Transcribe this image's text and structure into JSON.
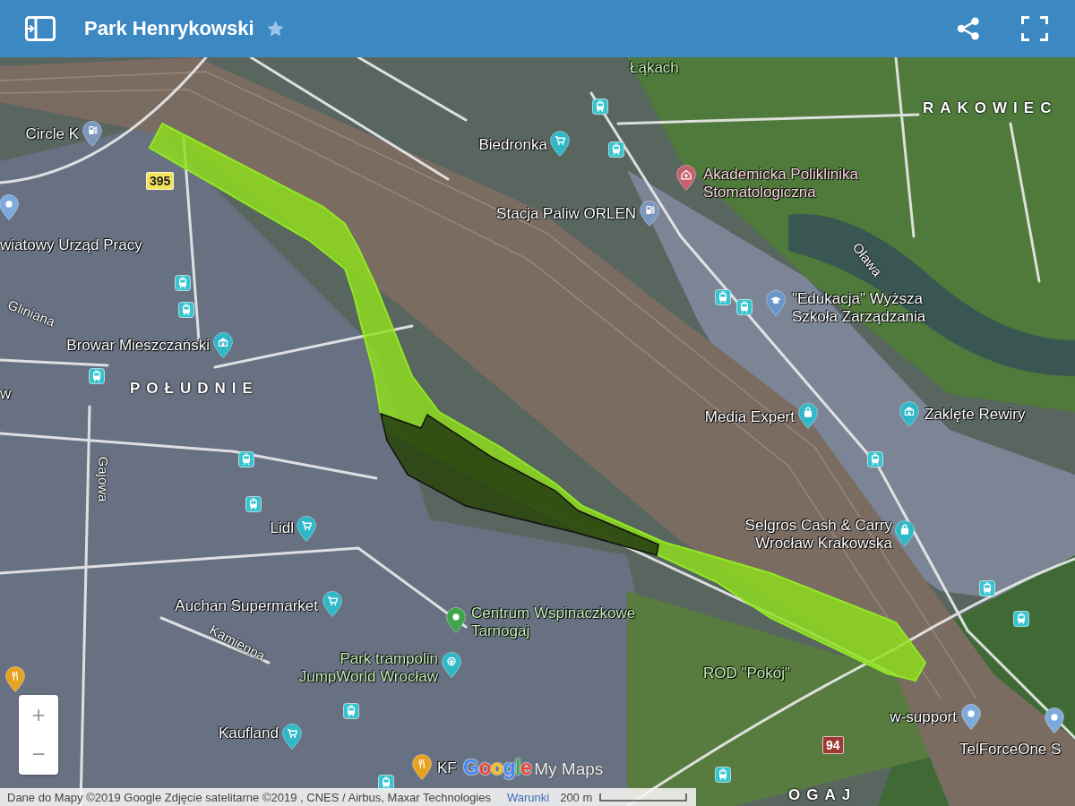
{
  "header": {
    "title": "Park Henrykowski"
  },
  "map": {
    "places": [
      {
        "name": "Łąkach",
        "kind": "none",
        "color": "#c6f2b8"
      },
      {
        "name": "Circle K",
        "kind": "fuel",
        "color": "#ffffff"
      },
      {
        "name": "Biedronka",
        "kind": "cart",
        "color": "#ffffff"
      },
      {
        "name": "Akademicka Poliklinika\nStomatologiczna",
        "kind": "clinic",
        "color": "#fbd7de"
      },
      {
        "name": "Stacja Paliw ORLEN",
        "kind": "fuel",
        "color": "#ffffff"
      },
      {
        "name": "wiatowy Urząd Pracy",
        "kind": "none",
        "color": "#ffffff"
      },
      {
        "name": "\"Edukacja\" Wyższa\nSzkoła Zarządzania",
        "kind": "school",
        "color": "#ffffff"
      },
      {
        "name": "Browar Mieszczański",
        "kind": "landmark",
        "color": "#ffffff"
      },
      {
        "name": "w",
        "kind": "none",
        "color": "#ffffff"
      },
      {
        "name": "Media Expert",
        "kind": "bag",
        "color": "#ffffff"
      },
      {
        "name": "Zaklęte Rewiry",
        "kind": "landmark",
        "color": "#ffffff"
      },
      {
        "name": "Lidl",
        "kind": "cart",
        "color": "#ffffff"
      },
      {
        "name": "Selgros Cash & Carry\nWrocław Krakowska",
        "kind": "bag",
        "color": "#ffffff"
      },
      {
        "name": "Auchan Supermarket",
        "kind": "cart",
        "color": "#ffffff"
      },
      {
        "name": "Centrum Wspinaczkowe\nTarnogaj",
        "kind": "venue",
        "color": "#c6f2b8"
      },
      {
        "name": "Park trampolin\nJumpWorld Wrocław",
        "kind": "amusement",
        "color": "#c6f2b8"
      },
      {
        "name": "ROD \"Pokój\"",
        "kind": "none",
        "color": "#c6f2b8"
      },
      {
        "name": "w-support",
        "kind": "pin",
        "color": "#ffffff"
      },
      {
        "name": "Kaufland",
        "kind": "cart",
        "color": "#ffffff"
      },
      {
        "name": "TelForceOne S",
        "kind": "pin",
        "color": "#ffffff"
      },
      {
        "name": "KF",
        "kind": "food",
        "color": "#ffffff"
      }
    ],
    "districts": [
      "RAKOWIEC",
      "POŁUDNIE",
      "OGAJ"
    ],
    "streets": [
      "Gliniana",
      "Gajowa",
      "Kamienna"
    ],
    "waterways": [
      "Oława"
    ],
    "road_badges": [
      {
        "number": "395",
        "color": "#f2e35a"
      },
      {
        "number": "94",
        "color": "#9a3b34"
      }
    ]
  },
  "zoom_controls": [
    "+",
    "−"
  ],
  "logo": {
    "brand": "Google",
    "product": "My Maps"
  },
  "attribution": {
    "text": "Dane do Mapy ©2019 Google Zdjęcie satelitarne ©2019 , CNES / Airbus, Maxar Technologies",
    "link": "Warunki",
    "scale": "200 m"
  }
}
